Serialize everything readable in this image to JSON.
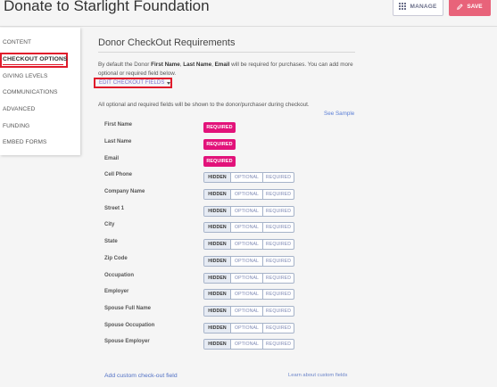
{
  "header": {
    "title": "Donate to Starlight Foundation",
    "manage_label": "MANAGE",
    "save_label": "SAVE"
  },
  "sidebar": {
    "items": [
      {
        "label": "CONTENT"
      },
      {
        "label": "CHECKOUT OPTIONS",
        "active": true
      },
      {
        "label": "GIVING LEVELS"
      },
      {
        "label": "COMMUNICATIONS"
      },
      {
        "label": "ADVANCED"
      },
      {
        "label": "FUNDING"
      },
      {
        "label": "EMBED FORMS"
      }
    ]
  },
  "main": {
    "title": "Donor CheckOut Requirements",
    "intro": {
      "prefix": "By default the Donor ",
      "first_name": "First Name",
      "sep1": ", ",
      "last_name": "Last Name",
      "sep2": ", ",
      "email": "Email",
      "suffix": " will be required for purchases. You can add more optional or required field below."
    },
    "edit_fields_label": "EDIT CHECKOUT FIELDS",
    "note": "All optional and required fields will be shown to the donor/purchaser during checkout.",
    "see_sample": "See Sample",
    "required_label": "REQUIRED",
    "options": {
      "hidden": "HIDDEN",
      "optional": "OPTIONAL",
      "required": "REQUIRED"
    },
    "fields": [
      {
        "label": "First Name",
        "locked": true
      },
      {
        "label": "Last Name",
        "locked": true
      },
      {
        "label": "Email",
        "locked": true
      },
      {
        "label": "Cell Phone",
        "selected": "HIDDEN"
      },
      {
        "label": "Company Name",
        "selected": "HIDDEN"
      },
      {
        "label": "Street 1",
        "selected": "HIDDEN"
      },
      {
        "label": "City",
        "selected": "HIDDEN"
      },
      {
        "label": "State",
        "selected": "HIDDEN"
      },
      {
        "label": "Zip Code",
        "selected": "HIDDEN"
      },
      {
        "label": "Occupation",
        "selected": "HIDDEN"
      },
      {
        "label": "Employer",
        "selected": "HIDDEN"
      },
      {
        "label": "Spouse Full Name",
        "selected": "HIDDEN"
      },
      {
        "label": "Spouse Occupation",
        "selected": "HIDDEN"
      },
      {
        "label": "Spouse Employer",
        "selected": "HIDDEN"
      }
    ],
    "add_custom_label": "Add custom check-out field",
    "learn_custom_label": "Learn about custom fields"
  }
}
